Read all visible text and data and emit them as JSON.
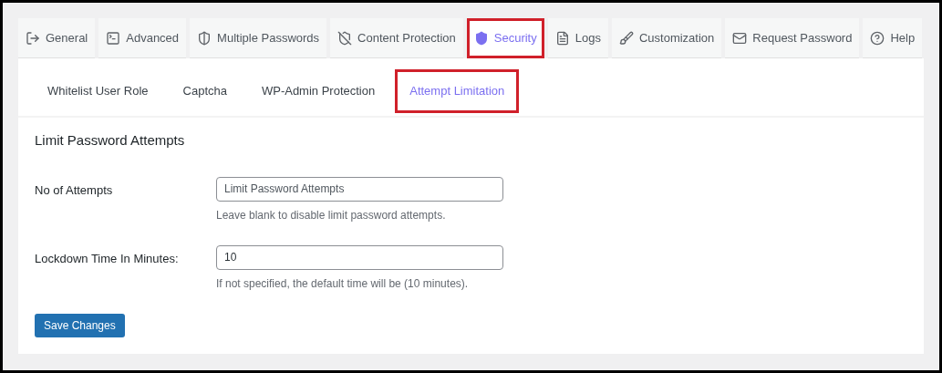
{
  "tabs": [
    {
      "label": "General",
      "kind": "general",
      "selected": false,
      "highlighted": false
    },
    {
      "label": "Advanced",
      "kind": "advanced",
      "selected": false,
      "highlighted": false
    },
    {
      "label": "Multiple Passwords",
      "kind": "passwords",
      "selected": false,
      "highlighted": false
    },
    {
      "label": "Content Protection",
      "kind": "protection",
      "selected": false,
      "highlighted": false
    },
    {
      "label": "Security",
      "kind": "security",
      "selected": true,
      "highlighted": true
    },
    {
      "label": "Logs",
      "kind": "logs",
      "selected": false,
      "highlighted": false
    },
    {
      "label": "Customization",
      "kind": "customization",
      "selected": false,
      "highlighted": false
    },
    {
      "label": "Request Password",
      "kind": "request",
      "selected": false,
      "highlighted": false
    },
    {
      "label": "Help",
      "kind": "help",
      "selected": false,
      "highlighted": false
    }
  ],
  "subtabs": [
    {
      "label": "Whitelist User Role",
      "selected": false,
      "highlighted": false
    },
    {
      "label": "Captcha",
      "selected": false,
      "highlighted": false
    },
    {
      "label": "WP-Admin Protection",
      "selected": false,
      "highlighted": false
    },
    {
      "label": "Attempt Limitation",
      "selected": true,
      "highlighted": true
    }
  ],
  "section_title": "Limit Password Attempts",
  "fields": [
    {
      "label": "No of Attempts",
      "placeholder": "Limit Password Attempts",
      "description": "Leave blank to disable limit password attempts."
    },
    {
      "label": "Lockdown Time In Minutes:",
      "value": "10",
      "description": "If not specified, the default time will be (10 minutes)."
    }
  ],
  "save_button": "Save Changes"
}
